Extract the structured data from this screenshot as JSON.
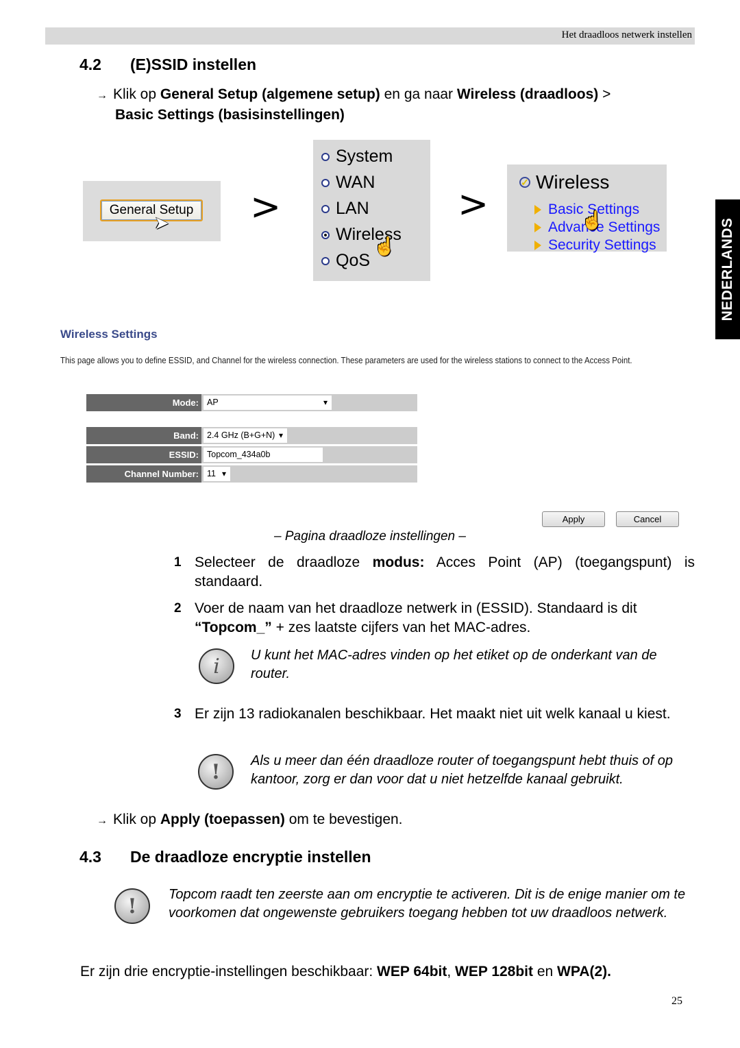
{
  "header": {
    "running_title": "Het draadloos netwerk instellen"
  },
  "section_42": {
    "number": "4.2",
    "title": "(E)SSID instellen",
    "instruction": {
      "prefix": "Klik op ",
      "bold1": "General Setup (algemene setup)",
      "middle": " en ga naar ",
      "bold2": "Wireless (draadloos)",
      "suffix": " >",
      "bold3": "Basic Settings (basisinstellingen)"
    }
  },
  "nav_screenshots": {
    "general_setup_button": "General Setup",
    "separator": ">",
    "menu_items": [
      {
        "label": "System",
        "selected": false
      },
      {
        "label": "WAN",
        "selected": false
      },
      {
        "label": "LAN",
        "selected": false
      },
      {
        "label": "Wireless",
        "selected": true
      },
      {
        "label": "QoS",
        "selected": false
      }
    ],
    "wireless_title": "Wireless",
    "wireless_links": [
      "Basic Settings",
      "Advance Settings",
      "Security Settings"
    ]
  },
  "side_tab": {
    "label": "NEDERLANDS"
  },
  "wireless_settings": {
    "title": "Wireless Settings",
    "description": "This page allows you to define ESSID, and Channel for the wireless connection. These parameters are used for the wireless stations to connect to the Access Point.",
    "fields": {
      "mode": {
        "label": "Mode:",
        "value": "AP"
      },
      "band": {
        "label": "Band:",
        "value": "2.4 GHz (B+G+N)"
      },
      "essid": {
        "label": "ESSID:",
        "value": "Topcom_434a0b"
      },
      "channel": {
        "label": "Channel Number:",
        "value": "11"
      }
    },
    "apply_label": "Apply",
    "cancel_label": "Cancel"
  },
  "caption": "– Pagina draadloze instellingen –",
  "steps": [
    {
      "num": "1",
      "pre": "Selecteer de draadloze  ",
      "bold": "modus:",
      "post": " Acces Point (AP) (toegangspunt) is standaard."
    },
    {
      "num": "2",
      "pre": "Voer de naam van het draadloze netwerk in (ESSID). Standaard is dit ",
      "bold": "“Topcom_”",
      "post": " + zes laatste cijfers van het MAC-adres."
    },
    {
      "num": "3",
      "pre": "Er zijn 13 radiokanalen beschikbaar. Het maakt niet uit welk kanaal u kiest.",
      "bold": "",
      "post": ""
    }
  ],
  "notes": {
    "info": "U kunt het MAC-adres vinden op het etiket op de onderkant van de router.",
    "warning_channel": "Als u meer dan één draadloze router of toegangspunt hebt thuis of op kantoor, zorg er dan voor dat u niet hetzelfde kanaal gebruikt.",
    "warning_encryption": "Topcom raadt ten zeerste aan om encryptie te activeren. Dit is de enige manier om te voorkomen dat ongewenste gebruikers toegang hebben tot uw draadloos netwerk."
  },
  "apply_instruction": {
    "prefix": "Klik op ",
    "bold": "Apply (toepassen)",
    "suffix": " om te bevestigen."
  },
  "section_43": {
    "number": "4.3",
    "title": "De draadloze encryptie instellen",
    "text": {
      "pre": "Er zijn drie encryptie-instellingen beschikbaar: ",
      "b1": "WEP 64bit",
      "sep": ", ",
      "b2": "WEP 128bit",
      "mid": " en ",
      "b3": "WPA(2)."
    }
  },
  "page_number": "25"
}
